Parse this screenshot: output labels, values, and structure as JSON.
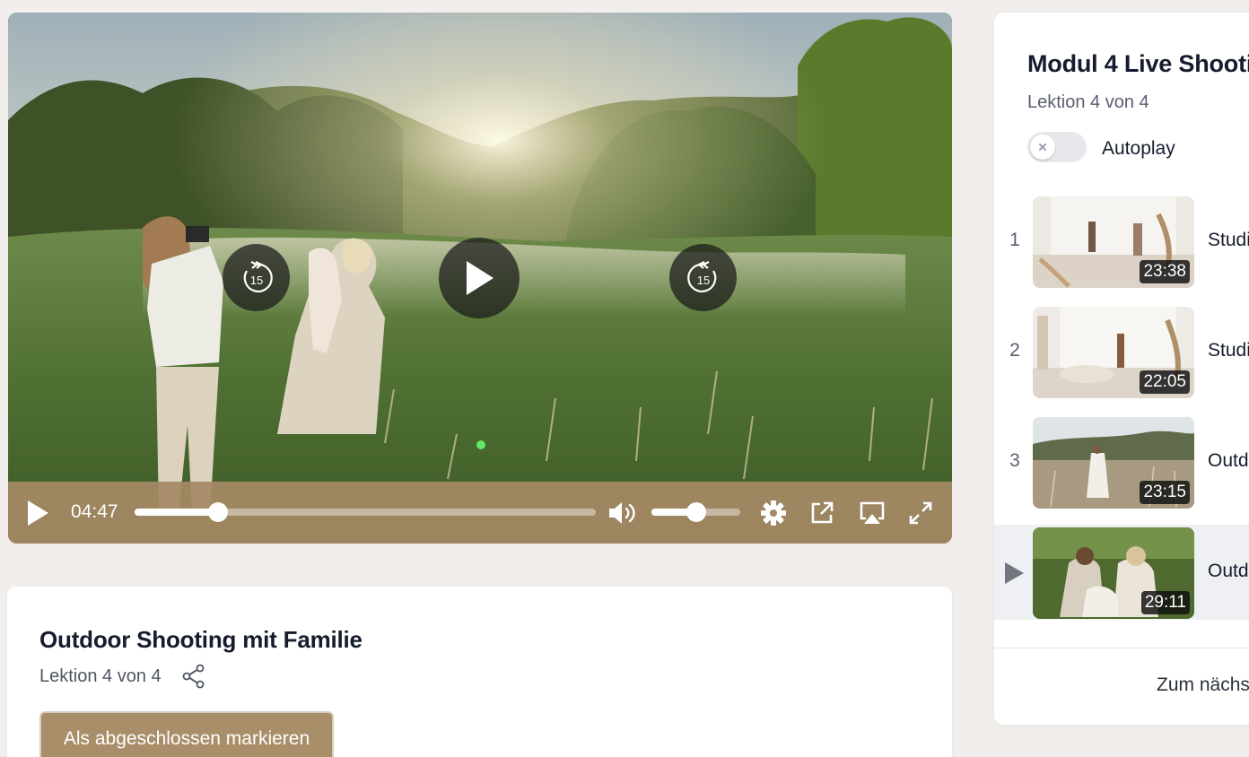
{
  "player": {
    "current_time": "04:47",
    "progress_fraction": 0.18,
    "volume_fraction": 0.5,
    "rewind_seconds": "15",
    "forward_seconds": "15",
    "icons": [
      "play-icon",
      "rewind-15-icon",
      "forward-15-icon",
      "volume-icon",
      "gear-icon",
      "popout-icon",
      "airplay-icon",
      "fullscreen-icon"
    ]
  },
  "lesson": {
    "title": "Outdoor Shooting mit Familie",
    "position": "Lektion 4 von 4",
    "mark_complete_label": "Als abgeschlossen markieren"
  },
  "sidebar": {
    "module_title": "Modul 4 Live Shooti",
    "position": "Lektion 4 von 4",
    "autoplay_label": "Autoplay",
    "autoplay_on": false,
    "lessons": [
      {
        "number": "1",
        "title": "Studi",
        "duration": "23:38",
        "active": false
      },
      {
        "number": "2",
        "title": "Studi",
        "duration": "22:05",
        "active": false
      },
      {
        "number": "3",
        "title": "Outd",
        "duration": "23:15",
        "active": false
      },
      {
        "number": "4",
        "title": "Outd",
        "duration": "29:11",
        "active": true
      }
    ],
    "next_label": "Zum nächs"
  },
  "colors": {
    "accent": "#a98e6a",
    "control_bar": "#a58964",
    "page_bg": "#f1eeeb",
    "active_row": "#eff0f3"
  }
}
